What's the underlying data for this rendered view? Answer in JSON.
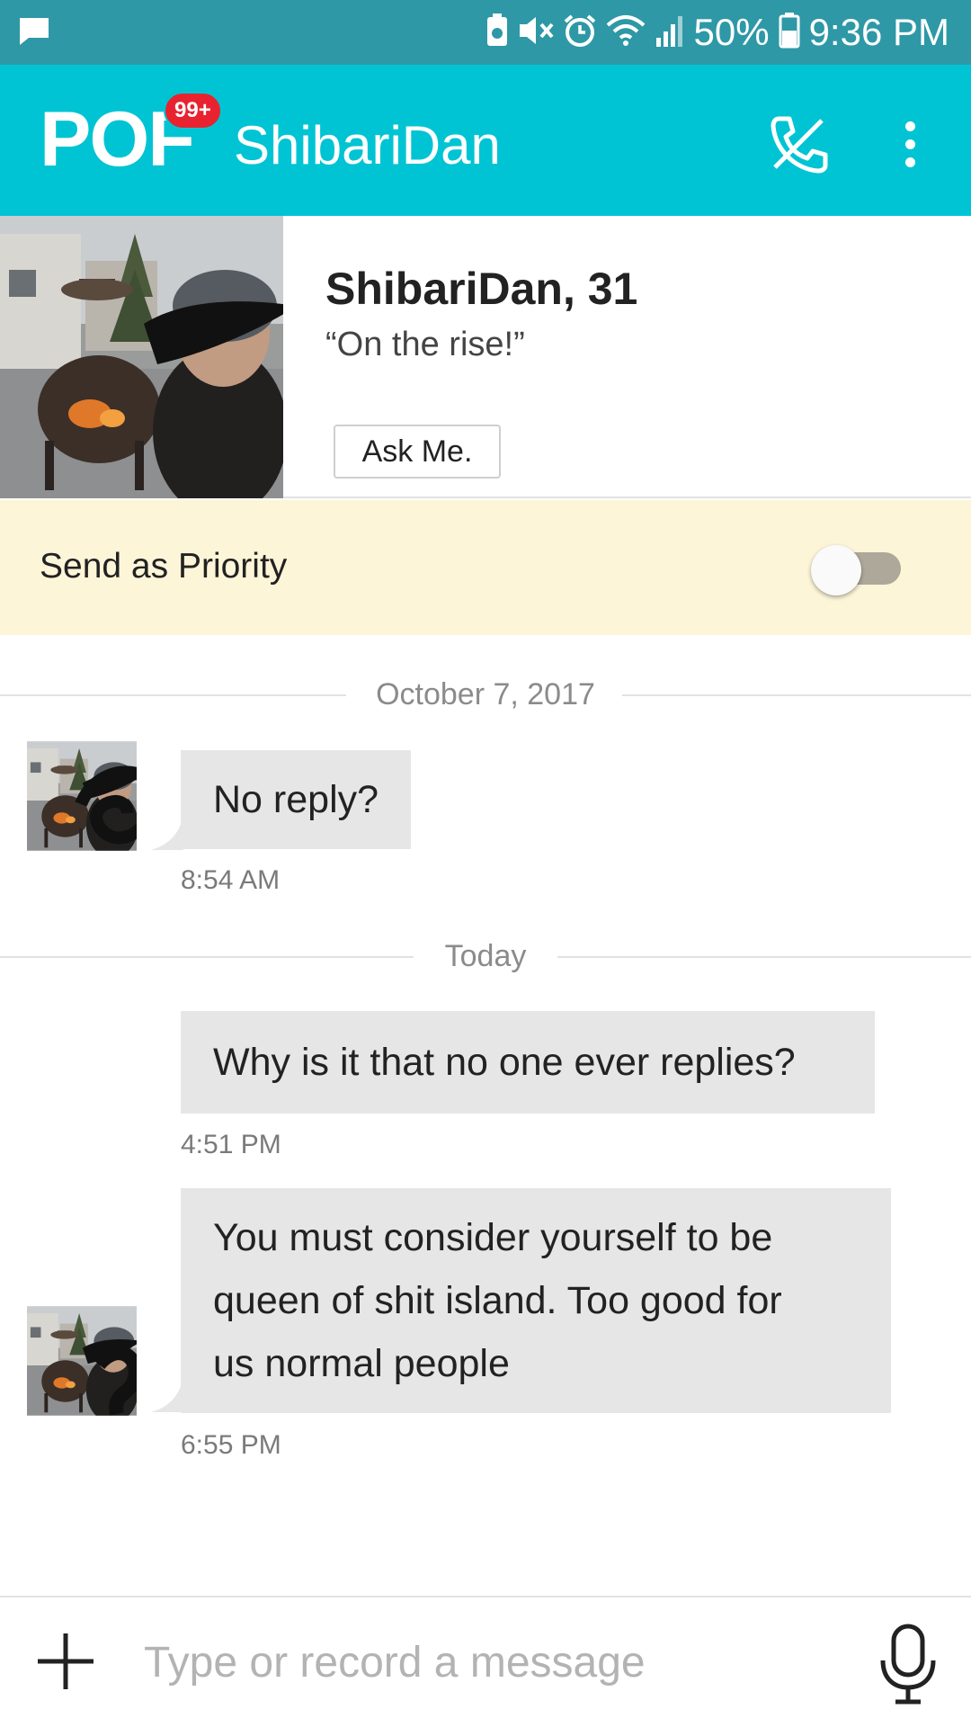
{
  "status_bar": {
    "battery": "50%",
    "time": "9:36 PM",
    "icons": [
      "chat-notification-icon",
      "recycle-icon",
      "mute-icon",
      "alarm-icon",
      "wifi-icon",
      "signal-icon",
      "battery-icon"
    ]
  },
  "header": {
    "logo": "POF",
    "badge": "99+",
    "title": "ShibariDan",
    "icons": [
      "call-icon",
      "more-vert-icon"
    ]
  },
  "profile": {
    "name_age": "ShibariDan, 31",
    "tagline": "“On the rise!”",
    "ask_button": "Ask Me."
  },
  "priority": {
    "label": "Send as Priority",
    "enabled": false
  },
  "conversation": {
    "sections": [
      {
        "date": "October 7, 2017",
        "messages": [
          {
            "text": "No reply?",
            "time": "8:54 AM",
            "from": "contact"
          }
        ]
      },
      {
        "date": "Today",
        "messages": [
          {
            "text": "Why is it that no one ever replies?",
            "time": "4:51 PM",
            "from": "contact"
          },
          {
            "lines": [
              "You must consider yourself to be",
              "queen of shit island. Too good for",
              "us normal people"
            ],
            "time": "6:55 PM",
            "from": "contact"
          }
        ]
      }
    ]
  },
  "composer": {
    "placeholder": "Type or record a message",
    "value": ""
  },
  "colors": {
    "status_bar": "#2E98A6",
    "app_bar": "#00C4D3",
    "badge": "#E8232F",
    "priority_bg": "#FDF5D8",
    "bubble": "#E6E6E6"
  }
}
